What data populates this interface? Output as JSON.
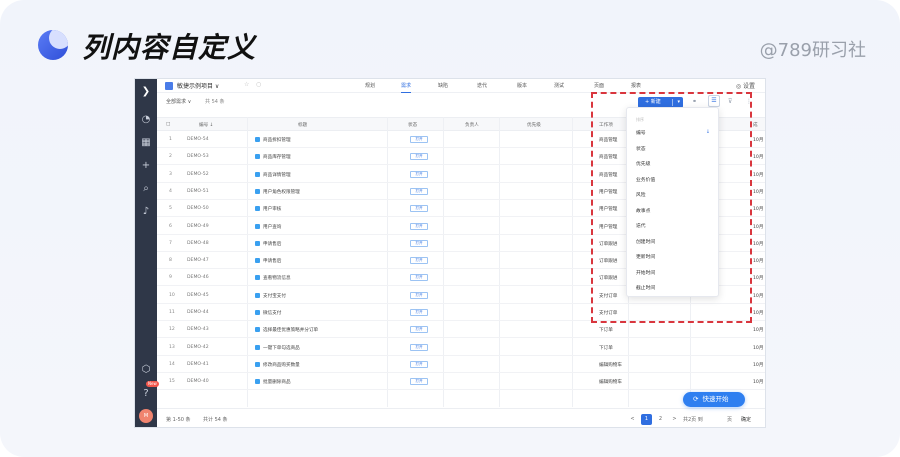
{
  "header": {
    "title": "列内容自定义",
    "watermark": "@789研习社"
  },
  "sidebar": {
    "icons": [
      "logo-icon",
      "dashboard-icon",
      "grid-icon",
      "plus-icon",
      "search-icon",
      "bell-icon",
      "cube-icon",
      "help-icon"
    ],
    "badge": "New",
    "avatar": "M"
  },
  "topbar": {
    "project": "敏捷示例项目 ∨",
    "nav": [
      {
        "label": "规划",
        "active": false
      },
      {
        "label": "需求",
        "active": true
      },
      {
        "label": "缺陷",
        "active": false
      },
      {
        "label": "迭代",
        "active": false
      },
      {
        "label": "版本",
        "active": false
      },
      {
        "label": "测试",
        "active": false
      },
      {
        "label": "页面",
        "active": false
      },
      {
        "label": "报表",
        "active": false
      }
    ],
    "settings": "◎ 设置"
  },
  "filter": {
    "all": "全部需求 ∨",
    "count": "共 54 条",
    "new_button": "+ 新建"
  },
  "table": {
    "headers": [
      "编号 ↓",
      "标题",
      "状态",
      "负责人",
      "优先级",
      "工作项",
      "成"
    ],
    "rows": [
      {
        "n": "1",
        "code": "DEMO-54",
        "title": "商品拆扣管理",
        "status": "打开",
        "type": "商品管理",
        "date": "10月"
      },
      {
        "n": "2",
        "code": "DEMO-53",
        "title": "商品库存管理",
        "status": "打开",
        "type": "商品管理",
        "date": "10月"
      },
      {
        "n": "3",
        "code": "DEMO-52",
        "title": "商品详情管理",
        "status": "打开",
        "type": "商品管理",
        "date": "10月"
      },
      {
        "n": "4",
        "code": "DEMO-51",
        "title": "用户角色权限管理",
        "status": "打开",
        "type": "用户管理",
        "date": "10月"
      },
      {
        "n": "5",
        "code": "DEMO-50",
        "title": "用户审核",
        "status": "打开",
        "type": "用户管理",
        "date": "10月"
      },
      {
        "n": "6",
        "code": "DEMO-49",
        "title": "用户查询",
        "status": "打开",
        "type": "用户管理",
        "date": "10月"
      },
      {
        "n": "7",
        "code": "DEMO-48",
        "title": "申请售后",
        "status": "打开",
        "type": "订单跟进",
        "date": "10月"
      },
      {
        "n": "8",
        "code": "DEMO-47",
        "title": "申请售后",
        "status": "打开",
        "type": "订单跟进",
        "date": "10月"
      },
      {
        "n": "9",
        "code": "DEMO-46",
        "title": "查看物流信息",
        "status": "打开",
        "type": "订单跟进",
        "date": "10月"
      },
      {
        "n": "10",
        "code": "DEMO-45",
        "title": "支付宝支付",
        "status": "打开",
        "type": "支付订单",
        "date": "10月"
      },
      {
        "n": "11",
        "code": "DEMO-44",
        "title": "微信支付",
        "status": "打开",
        "type": "支付订单",
        "date": "10月"
      },
      {
        "n": "12",
        "code": "DEMO-43",
        "title": "选择最佳优惠策略并分订单",
        "status": "打开",
        "type": "下订单",
        "date": "10月"
      },
      {
        "n": "13",
        "code": "DEMO-42",
        "title": "一键下单勾选商品",
        "status": "打开",
        "type": "下订单",
        "date": "10月"
      },
      {
        "n": "14",
        "code": "DEMO-41",
        "title": "修改商品购买数量",
        "status": "打开",
        "type": "编辑购物车",
        "date": "10月"
      },
      {
        "n": "15",
        "code": "DEMO-40",
        "title": "批量删除商品",
        "status": "打开",
        "type": "编辑购物车",
        "date": "10月"
      }
    ]
  },
  "footer": {
    "range": "第 1-50 条",
    "total": "共计 54 条",
    "prev": "<",
    "pages": [
      "1",
      "2"
    ],
    "next": ">",
    "goto": "共2页 到",
    "page_label": "页",
    "confirm": "确定"
  },
  "quick_start": "快速开始",
  "dropdown": {
    "header": "排序",
    "items": [
      "编号",
      "状态",
      "优先级",
      "业务价值",
      "风险",
      "故事点",
      "迭代",
      "创建时间",
      "更新时间",
      "开始时间",
      "截止时间"
    ],
    "arrow": "↓"
  },
  "colors": {
    "primary": "#2f6ee0",
    "sidebar": "#2f3748",
    "highlight": "#d9363e"
  }
}
